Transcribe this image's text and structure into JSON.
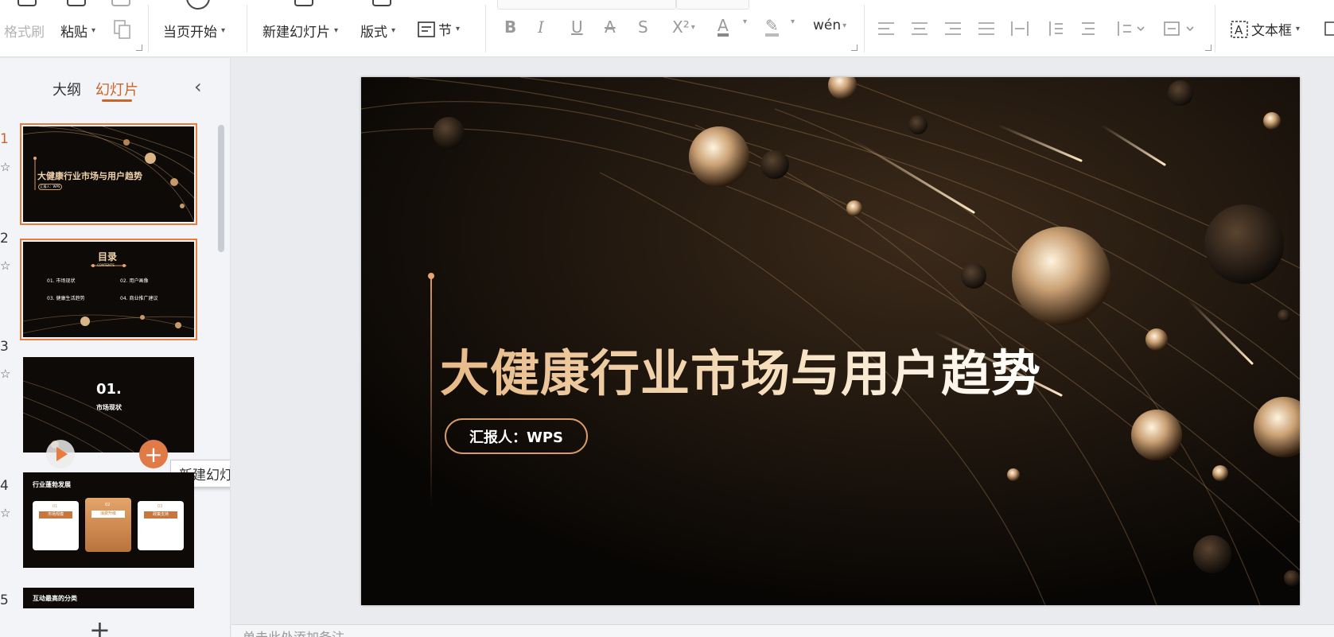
{
  "ribbon": {
    "format_painter": "格式刷",
    "paste": "粘贴",
    "from_current": "当页开始",
    "new_slide": "新建幻灯片",
    "layout": "版式",
    "section": "节",
    "textbox": "文本框",
    "fmt": {
      "bold": "B",
      "italic": "I",
      "underline": "U",
      "strike": "A",
      "shadow": "S",
      "superscript": "X²",
      "font_color": "A",
      "highlight": "✎",
      "phonetic": "wén"
    }
  },
  "panel": {
    "tabs": [
      "大纲",
      "幻灯片"
    ],
    "active_tab": 1
  },
  "thumbnails": [
    {
      "num": "1",
      "title": "大健康行业市场与用户趋势",
      "sub": "汇报人：WPS"
    },
    {
      "num": "2",
      "title": "目录",
      "sub": "CONTENTS",
      "items": [
        "01. 市场现状",
        "02. 用户画像",
        "03. 健康生活趋势",
        "04. 商业推广建议"
      ]
    },
    {
      "num": "3",
      "title": "01.",
      "sub": "市场现状"
    },
    {
      "num": "4",
      "title": "行业蓬勃发展",
      "cards": [
        "市场规模",
        "消费升级",
        "政策支持"
      ],
      "card_nums": [
        "01",
        "02",
        "03"
      ]
    },
    {
      "num": "5",
      "title": "互动最高的分类"
    }
  ],
  "tooltip": "新建幻灯片",
  "slide": {
    "title": "大健康行业市场与用户趋势",
    "reporter": "汇报人：WPS"
  },
  "notes_placeholder": "单击此处添加备注",
  "colors": {
    "accent": "#c8652a",
    "slide_bg": "#080604",
    "gold": "#e7b987"
  }
}
